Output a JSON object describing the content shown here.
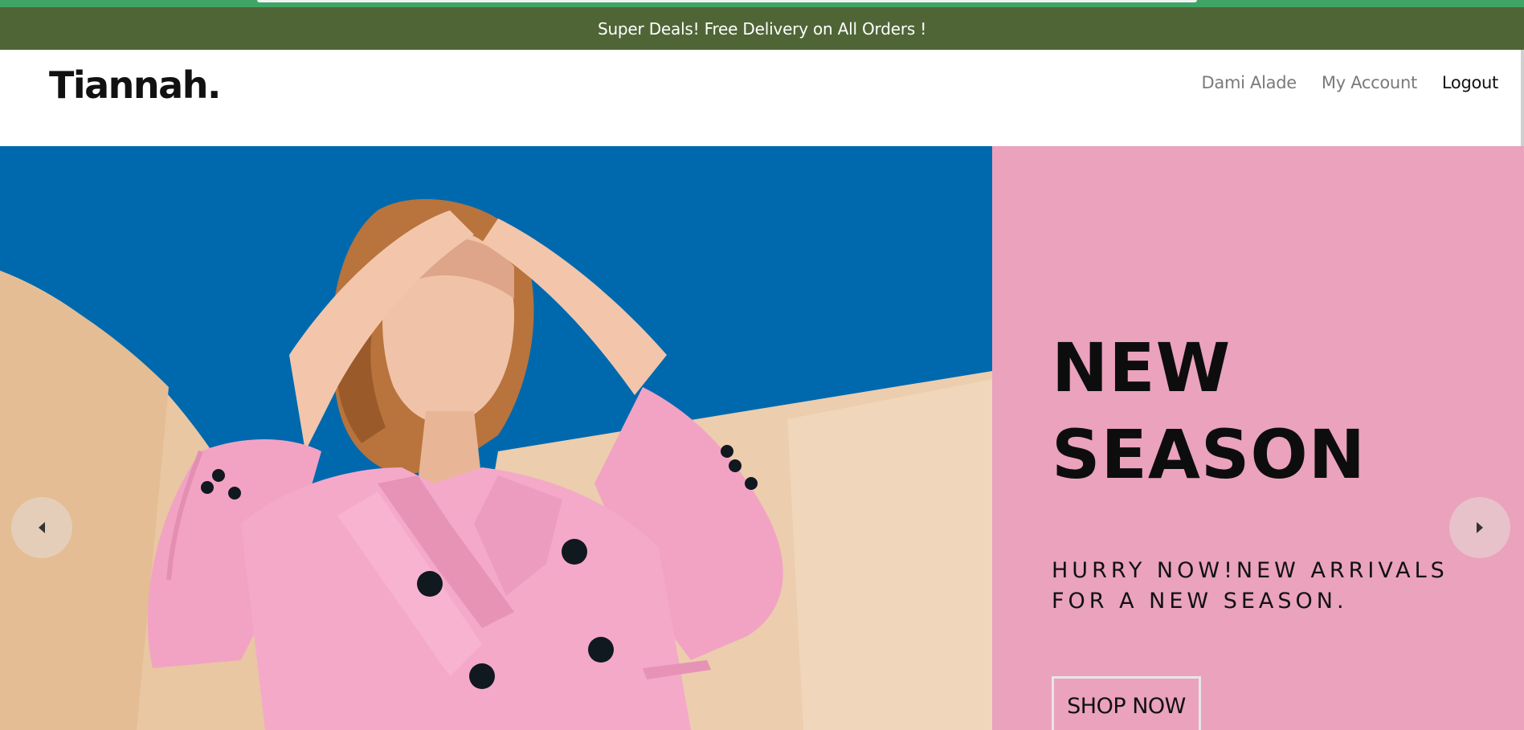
{
  "promo": {
    "text": "Super Deals! Free Delivery on All Orders !"
  },
  "header": {
    "logo": "Tiannah.",
    "nav": [
      {
        "label": "Dami Alade"
      },
      {
        "label": "My Account"
      },
      {
        "label": "Logout"
      }
    ]
  },
  "hero": {
    "headline_line1": "NEW",
    "headline_line2": "SEASON",
    "subheadline_line1": "HURRY NOW!NEW ARRIVALS",
    "subheadline_line2": "FOR A NEW SEASON.",
    "cta_label": "SHOP NOW",
    "image_icon": "model-pink-blazer-photo",
    "prev_icon": "chevron-left-icon",
    "next_icon": "chevron-right-icon"
  },
  "colors": {
    "promo_bg": "#4f6536",
    "panel_bg": "#eaa2bd",
    "sky": "#0069ad",
    "blazer": "#f2a3c4",
    "wall": "#e9c7a2"
  }
}
